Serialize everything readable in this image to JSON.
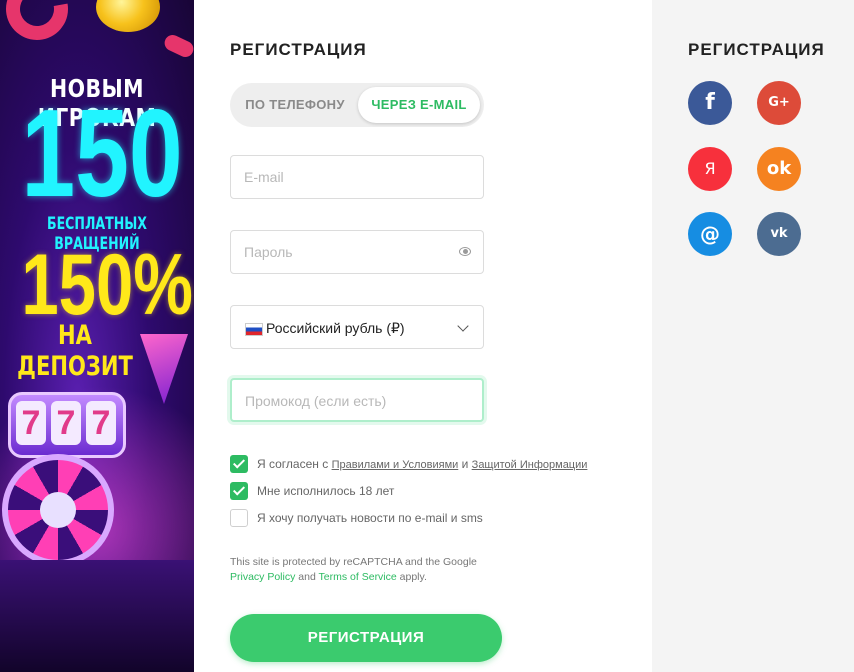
{
  "promo": {
    "line1": "НОВЫМ ИГРОКАМ",
    "big_number": "150",
    "line2": "БЕСПЛАТНЫХ ВРАЩЕНИЙ",
    "percent": "150%",
    "line3": "НА ДЕПОЗИТ",
    "slot_digits": [
      "7",
      "7",
      "7"
    ]
  },
  "form": {
    "title": "РЕГИСТРАЦИЯ",
    "tabs": [
      {
        "label": "ПО ТЕЛЕФОНУ",
        "active": false
      },
      {
        "label": "ЧЕРЕЗ E-MAIL",
        "active": true
      }
    ],
    "email_placeholder": "E-mail",
    "password_placeholder": "Пароль",
    "currency": "Российский рубль (₽)",
    "promo_placeholder": "Промокод (если есть)",
    "checks": [
      {
        "checked": true,
        "text_before": "Я согласен с",
        "link1": "Правилами и Условиями",
        "text_mid": "и",
        "link2": "Защитой Информации"
      },
      {
        "checked": true,
        "text": "Мне исполнилось 18 лет"
      },
      {
        "checked": false,
        "text": "Я хочу получать новости по e-mail и sms"
      }
    ],
    "recaptcha": {
      "line1": "This site is protected by reCAPTCHA and the Google",
      "privacy": "Privacy Policy",
      "and": "and",
      "terms": "Terms of Service",
      "apply": "apply."
    },
    "submit_label": "РЕГИСТРАЦИЯ"
  },
  "social": {
    "title": "РЕГИСТРАЦИЯ",
    "buttons": [
      {
        "icon": "facebook-icon",
        "glyph": "f",
        "color": "#3b5998"
      },
      {
        "icon": "google-plus-icon",
        "glyph": "G+",
        "color": "#dd4b39"
      },
      {
        "icon": "yandex-icon",
        "glyph": "Я",
        "color": "#f7303c"
      },
      {
        "icon": "odnoklassniki-icon",
        "glyph": "ok",
        "color": "#f58220"
      },
      {
        "icon": "mailru-icon",
        "glyph": "@",
        "color": "#168de2"
      },
      {
        "icon": "vk-icon",
        "glyph": "vk",
        "color": "#4c6c91"
      }
    ]
  },
  "colors": {
    "accent_green": "#2dbb62",
    "submit_green": "#3bcb6e",
    "promo_cyan": "#21f4ff",
    "promo_yellow": "#ffe81a"
  }
}
